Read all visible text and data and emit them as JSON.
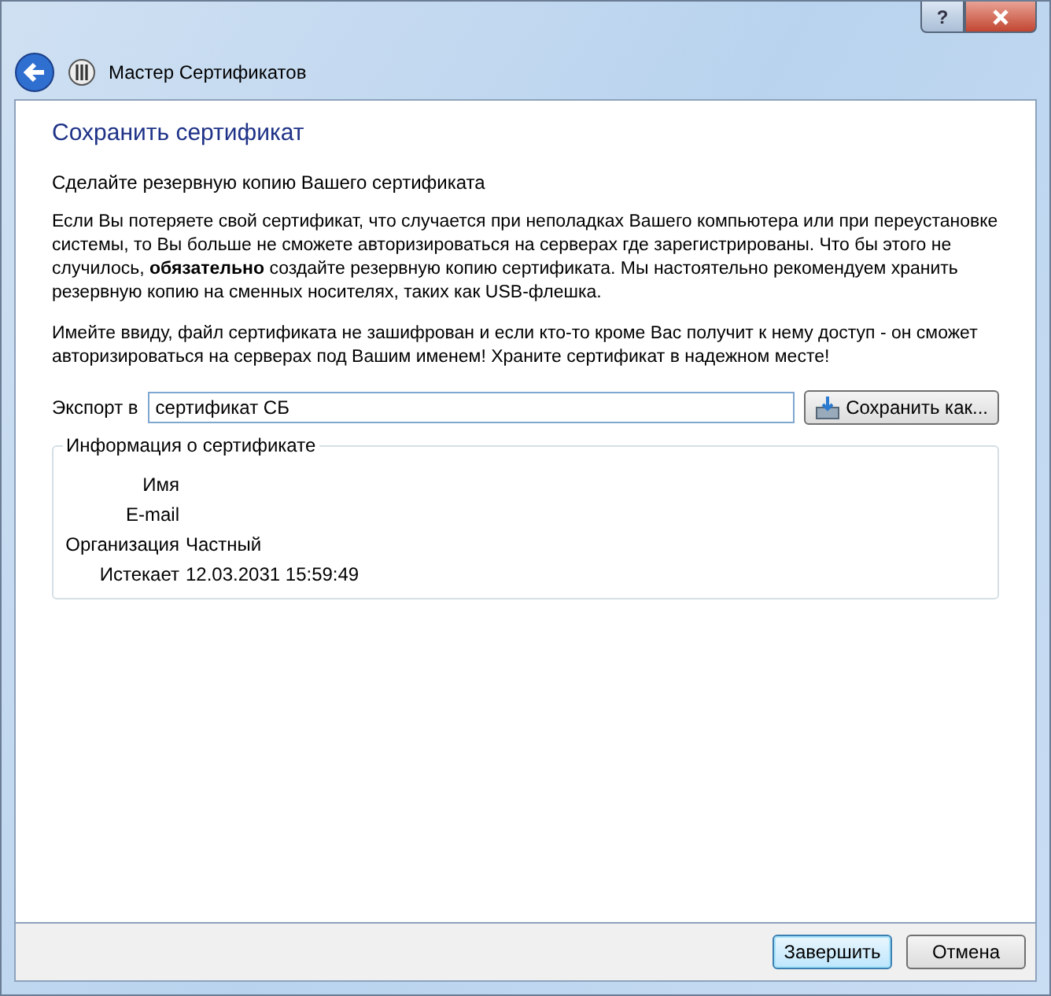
{
  "window": {
    "title": "Мастер Сертификатов",
    "help": "?"
  },
  "page": {
    "heading": "Сохранить сертификат",
    "subtitle": "Сделайте резервную копию Вашего сертификата",
    "paragraphs": [
      "Если Вы потеряете свой сертификат, что случается при неполадках Вашего компьютера или при переустановке системы, то Вы больше не сможете авторизироваться на серверах где зарегистрированы. Что бы этого не случилось, **обязательно** создайте резервную копию сертификата. Мы настоятельно рекомендуем хранить резервную копию на сменных носителях, таких как USB-флешка.",
      "Имейте ввиду, файл сертификата не зашифрован и если кто-то кроме Вас получит к нему доступ - он сможет авторизироваться на серверах под Вашим именем! Храните сертификат в надежном месте!"
    ]
  },
  "export": {
    "label": "Экспорт в",
    "value": "сертификат СБ",
    "button": "Сохранить как..."
  },
  "info": {
    "title": "Информация о сертификате",
    "rows": [
      {
        "label": "Имя"
      },
      {
        "label": "E-mail"
      },
      {
        "label": "Организация",
        "value": "Частный"
      },
      {
        "label": "Истекает",
        "value": "12.03.2031 15:59:49"
      }
    ]
  },
  "buttons": [
    {
      "label": "Завершить",
      "default": true
    },
    {
      "label": "Отмена",
      "default": false
    }
  ]
}
